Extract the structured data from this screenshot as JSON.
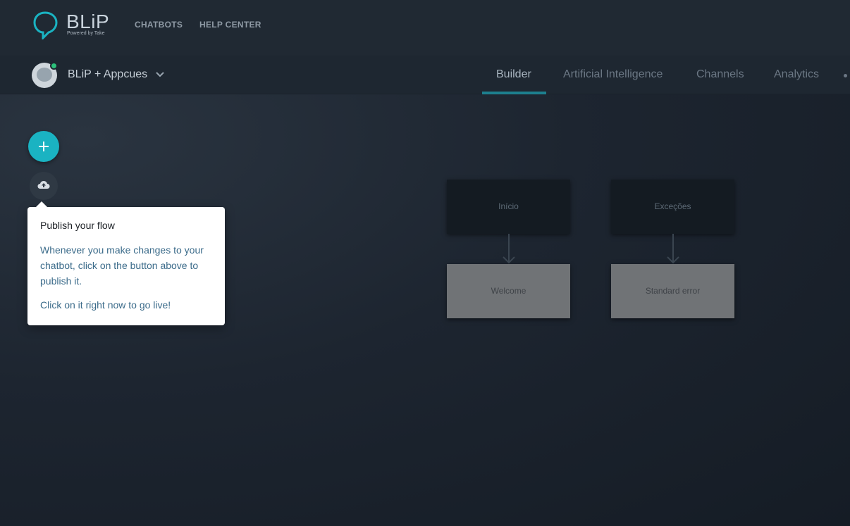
{
  "brand": {
    "name": "BLiP",
    "tagline": "Powered by Take"
  },
  "topnav": {
    "chatbots": "CHATBOTS",
    "help_center": "HELP CENTER"
  },
  "bot": {
    "name": "BLiP + Appcues",
    "status": "online"
  },
  "tabs": [
    {
      "label": "Builder",
      "active": true
    },
    {
      "label": "Artificial Intelligence",
      "active": false
    },
    {
      "label": "Channels",
      "active": false
    },
    {
      "label": "Analytics",
      "active": false
    }
  ],
  "tooltip": {
    "title": "Publish your flow",
    "body": "Whenever you make changes to your chatbot, click on the button above to publish it.",
    "cta": "Click on it right now to go live!"
  },
  "flow": {
    "nodes": [
      {
        "label": "Início"
      },
      {
        "label": "Exceções"
      },
      {
        "label": "Welcome"
      },
      {
        "label": "Standard error"
      }
    ]
  },
  "colors": {
    "accent": "#1ab3c2",
    "online": "#2cc17b",
    "tab_underline": "#1d7f8e"
  },
  "icons": {
    "add": "plus-icon",
    "publish": "cloud-upload-icon",
    "dropdown": "chevron-down-icon"
  }
}
